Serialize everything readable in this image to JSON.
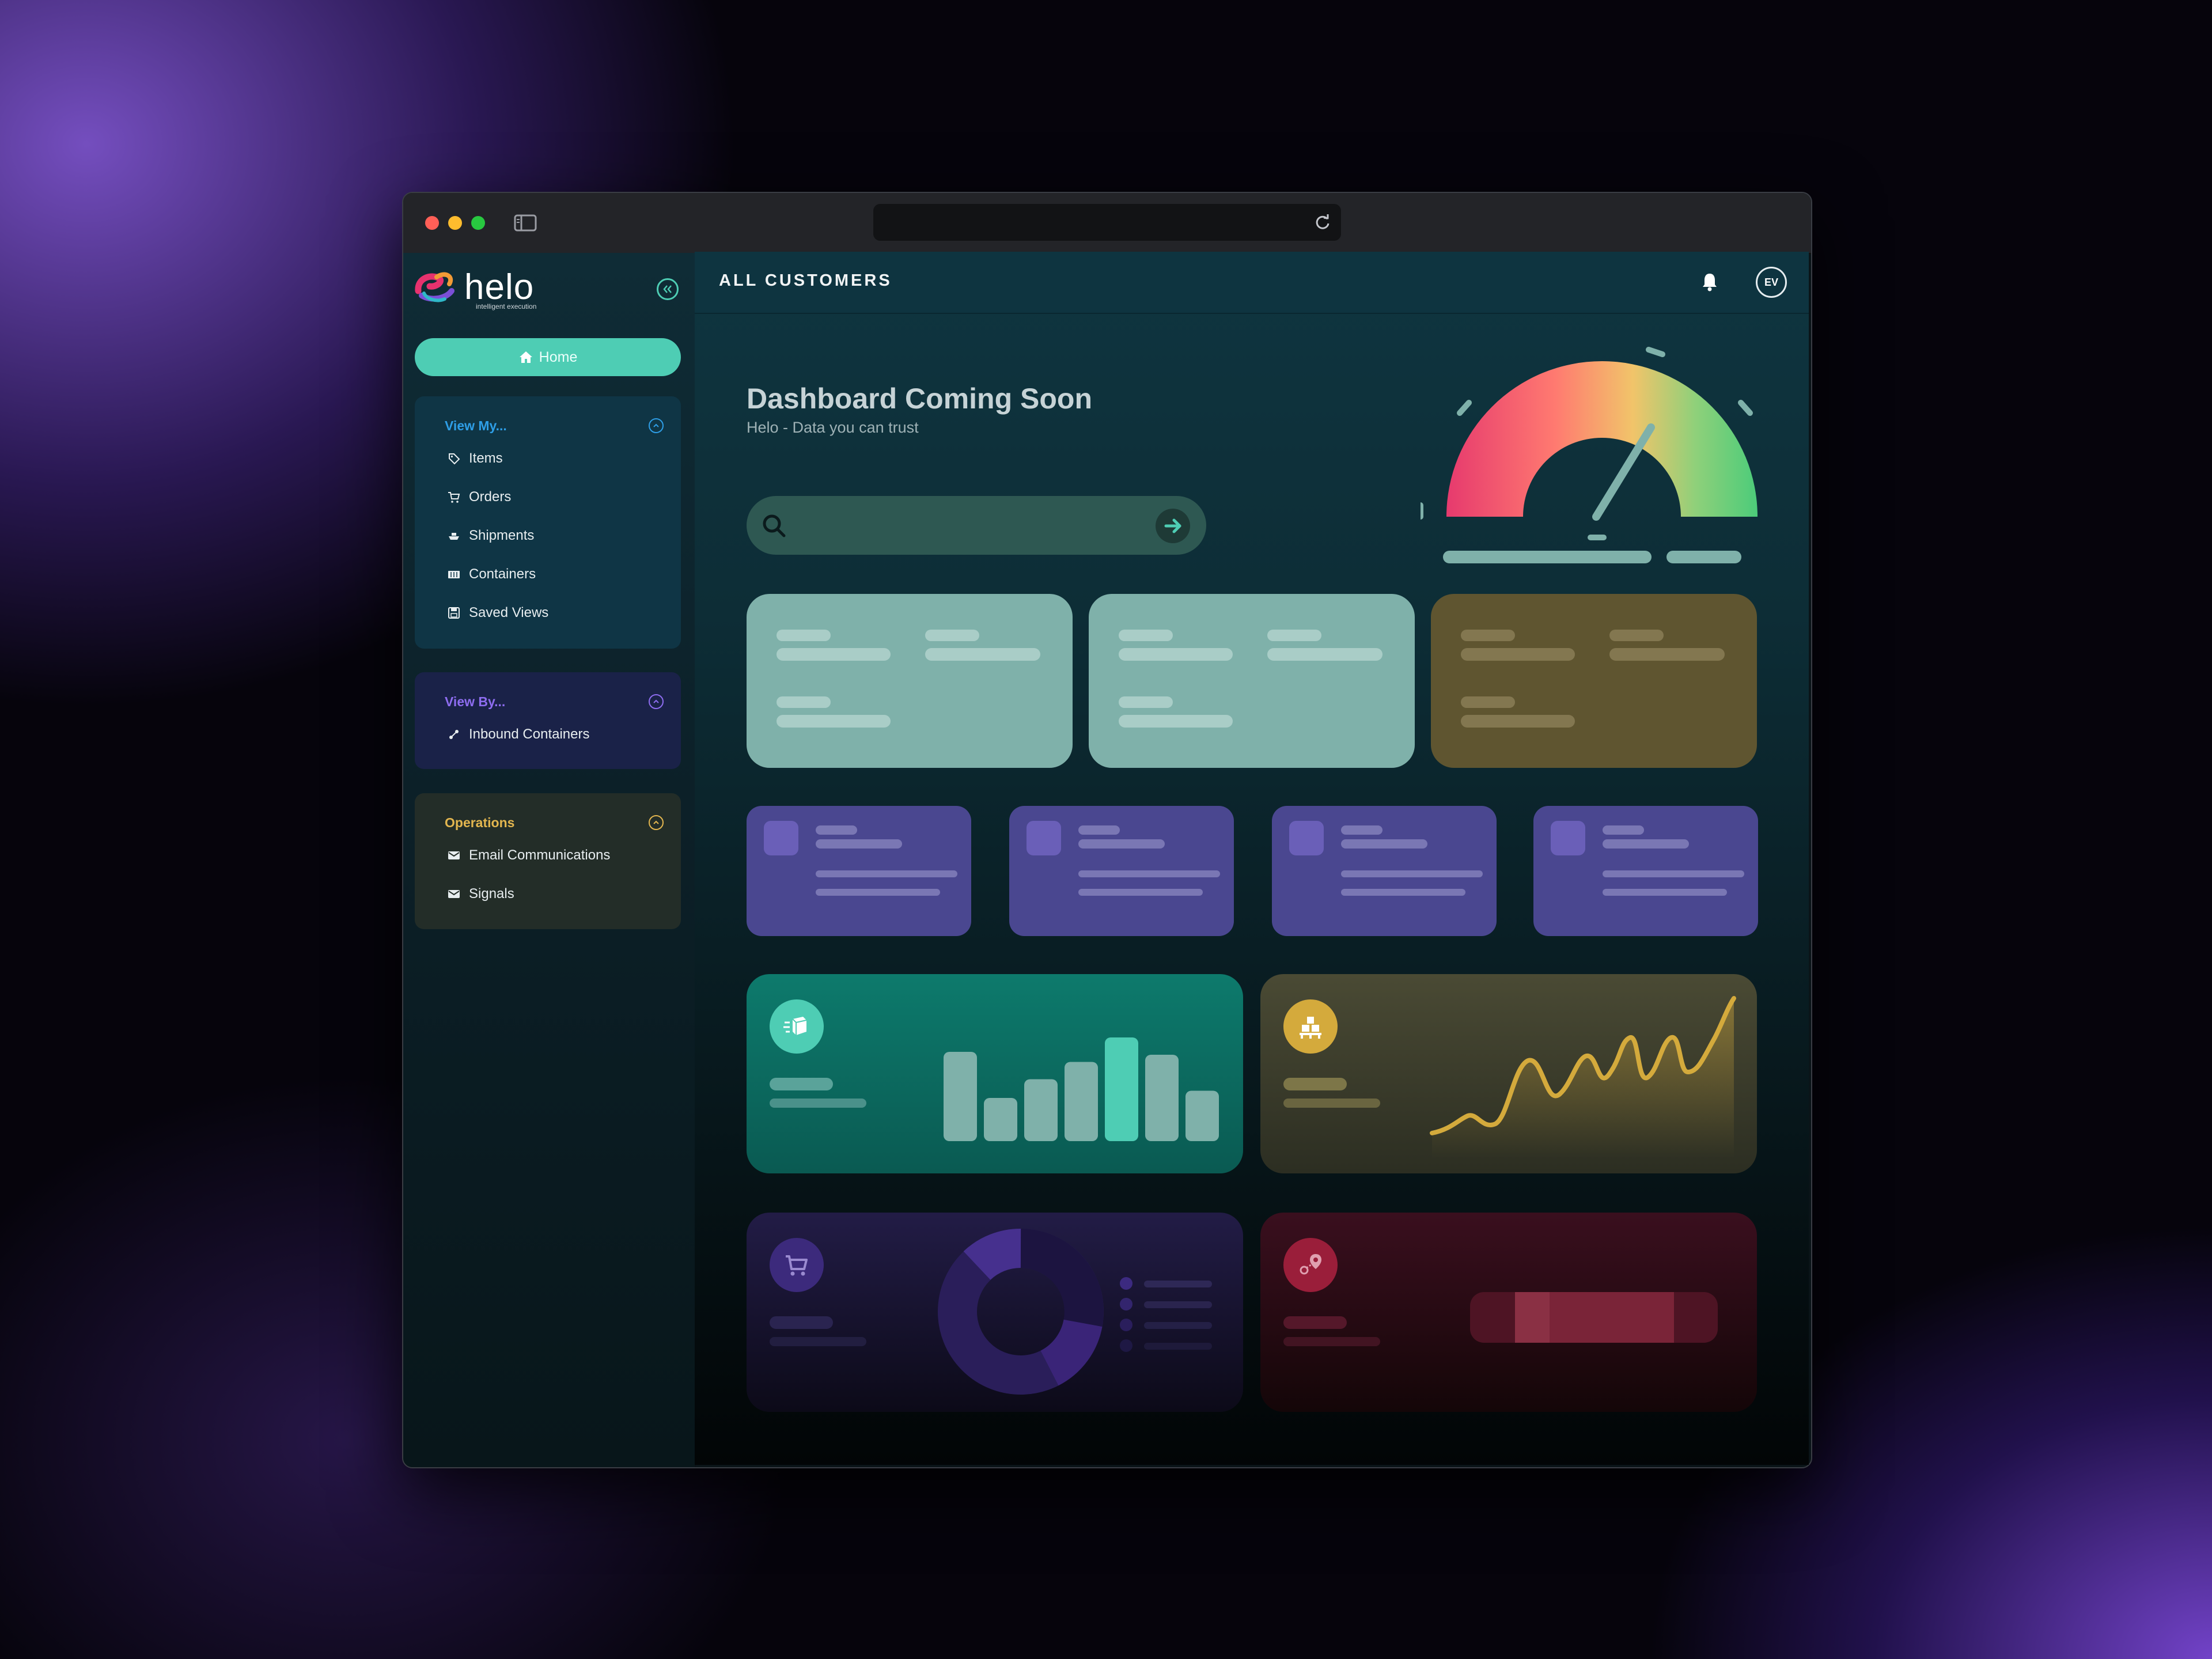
{
  "browser": {
    "colors": {
      "close": "#ff5f57",
      "minimize": "#febc2e",
      "maximize": "#28c840"
    },
    "address_value": ""
  },
  "sidebar": {
    "logo": {
      "name": "helo",
      "tagline": "intelligent execution"
    },
    "collapse_icon": "chevrons-left-icon",
    "home_label": "Home",
    "sections": [
      {
        "title": "View My...",
        "color": "#2e9ee6",
        "items": [
          {
            "label": "Items",
            "icon": "tag-icon"
          },
          {
            "label": "Orders",
            "icon": "cart-icon"
          },
          {
            "label": "Shipments",
            "icon": "ship-icon"
          },
          {
            "label": "Containers",
            "icon": "container-icon"
          },
          {
            "label": "Saved Views",
            "icon": "save-icon"
          }
        ]
      },
      {
        "title": "View By...",
        "color": "#8e6df0",
        "items": [
          {
            "label": "Inbound Containers",
            "icon": "inbound-icon"
          }
        ]
      },
      {
        "title": "Operations",
        "color": "#e3b64f",
        "items": [
          {
            "label": "Email Communications",
            "icon": "envelope-icon"
          },
          {
            "label": "Signals",
            "icon": "envelope-icon"
          }
        ]
      }
    ]
  },
  "header": {
    "title": "ALL CUSTOMERS",
    "notification_icon": "bell-icon",
    "avatar_initials": "EV"
  },
  "main": {
    "heading": "Dashboard Coming Soon",
    "subheading": "Helo - Data you can trust",
    "search_value": "",
    "colors": {
      "teal": "#7fb1aa",
      "olive": "#5f5530",
      "purple": "#4a4790",
      "accent": "#4ecdb4",
      "gold": "#d4aa3c",
      "crimson": "#c02848"
    },
    "chart_icons": [
      "boxes-icon",
      "pallet-icon",
      "cart-icon",
      "map-pin-icon"
    ],
    "bars": [
      0.62,
      0.3,
      0.43,
      0.55,
      0.72,
      0.6,
      0.35
    ]
  }
}
